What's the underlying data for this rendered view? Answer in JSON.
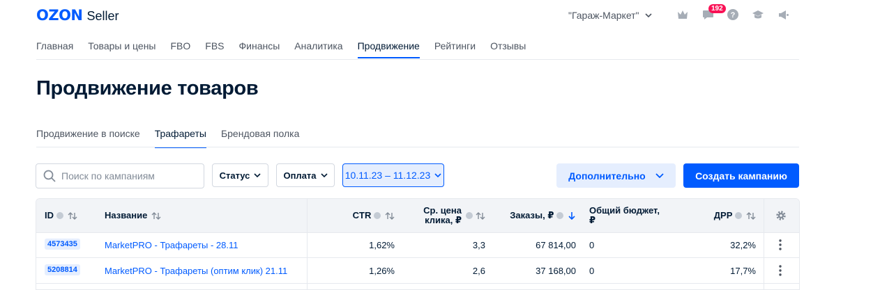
{
  "header": {
    "logo_brand": "OZON",
    "logo_product": "Seller",
    "shop_selector": "\"Гараж-Маркет\"",
    "messages_badge": "192"
  },
  "main_nav": [
    "Главная",
    "Товары и цены",
    "FBO",
    "FBS",
    "Финансы",
    "Аналитика",
    "Продвижение",
    "Рейтинги",
    "Отзывы"
  ],
  "main_nav_active": "Продвижение",
  "page_title": "Продвижение товаров",
  "sub_nav": [
    "Продвижение в поиске",
    "Трафареты",
    "Брендовая полка"
  ],
  "sub_nav_active": "Трафареты",
  "toolbar": {
    "search_placeholder": "Поиск по кампаниям",
    "status_label": "Статус",
    "payment_label": "Оплата",
    "date_range": "10.11.23 – 11.12.23",
    "more_label": "Дополнительно",
    "create_label": "Создать кампанию"
  },
  "table": {
    "headers": {
      "id": "ID",
      "name": "Название",
      "ctr": "CTR",
      "cpc_line1": "Ср. цена",
      "cpc_line2": "клика, ₽",
      "orders": "Заказы, ₽",
      "budget_line1": "Общий бюджет,",
      "budget_line2": "₽",
      "drr": "ДРР"
    },
    "rows": [
      {
        "id": "4573435",
        "name": "MarketPRO - Трафареты - 28.11",
        "ctr": "1,62%",
        "cpc": "3,3",
        "orders": "67 814,00",
        "budget": "0",
        "drr": "32,2%"
      },
      {
        "id": "5208814",
        "name": "MarketPRO - Трафареты (оптим клик) 21.11",
        "ctr": "1,26%",
        "cpc": "2,6",
        "orders": "37 168,00",
        "budget": "0",
        "drr": "17,7%"
      }
    ]
  },
  "colors": {
    "accent": "#005bff",
    "accent_light": "#e5eefe",
    "badge": "#f91155",
    "text": "#001a34",
    "muted": "#4d5561"
  }
}
